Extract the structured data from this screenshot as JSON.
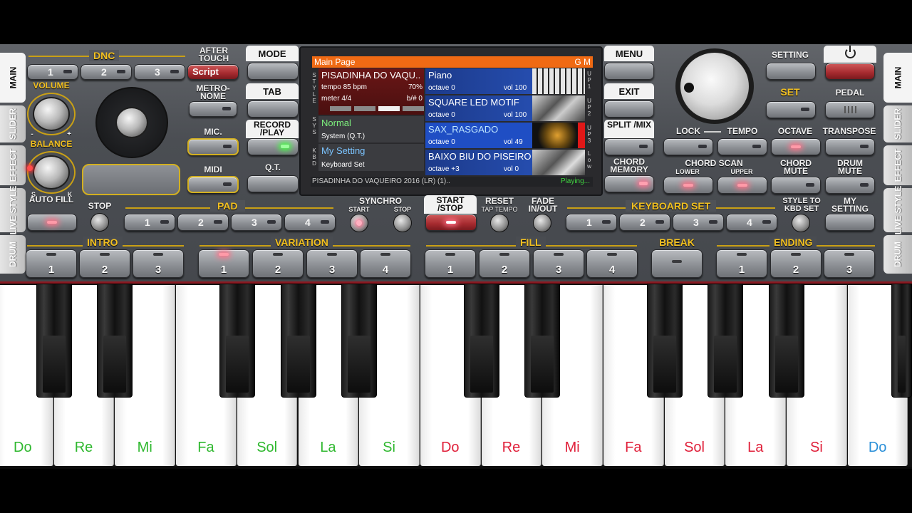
{
  "side_tabs_left": [
    "MAIN",
    "SLIDER",
    "EFFECT",
    "LIVE STYLE",
    "DRUM"
  ],
  "side_tabs_right": [
    "MAIN",
    "SLIDER",
    "EFFECT",
    "LIVE STYLE",
    "DRUM"
  ],
  "dnc": {
    "label": "DNC",
    "buttons": [
      "1",
      "2",
      "3"
    ]
  },
  "after_touch": {
    "label": "AFTER TOUCH",
    "value": "Script"
  },
  "volume_label": "VOLUME",
  "balance_label": "BALANCE",
  "balance_s": "S",
  "balance_k": "K",
  "volume_minus": "-",
  "volume_plus": "+",
  "metronome_label": "METRO-NOME",
  "mic_label": "MIC.",
  "midi_label": "MIDI",
  "mode_label": "MODE",
  "tab_label": "TAB",
  "record_label": "RECORD /PLAY",
  "qt_label": "Q.T.",
  "menu_label": "MENU",
  "exit_label": "EXIT",
  "split_label": "SPLIT /MIX",
  "chord_memory_label": "CHORD MEMORY",
  "setting_label": "SETTING",
  "set_label": "SET",
  "pedal_label": "PEDAL",
  "lock_label": "LOCK",
  "tempo_label": "TEMPO",
  "octave_label": "OCTAVE",
  "transpose_label": "TRANSPOSE",
  "chord_scan": {
    "label": "CHORD SCAN",
    "lower": "LOWER",
    "upper": "UPPER"
  },
  "chord_mute_label": "CHORD MUTE",
  "drum_mute_label": "DRUM MUTE",
  "auto_fill_label": "AUTO FILL",
  "stop_label": "STOP",
  "pad": {
    "label": "PAD",
    "buttons": [
      "1",
      "2",
      "3",
      "4"
    ]
  },
  "synchro": {
    "label": "SYNCHRO",
    "start": "START",
    "stop": "STOP"
  },
  "start_stop_label": "START /STOP",
  "reset_label": "RESET",
  "tap_tempo_label": "TAP TEMPO",
  "fade_label": "FADE IN/OUT",
  "keyboard_set": {
    "label": "KEYBOARD SET",
    "buttons": [
      "1",
      "2",
      "3",
      "4"
    ]
  },
  "style_to_kbd_label": "STYLE TO KBD SET",
  "my_setting_label": "MY SETTING",
  "intro": {
    "label": "INTRO",
    "buttons": [
      "1",
      "2",
      "3"
    ]
  },
  "variation": {
    "label": "VARIATION",
    "buttons": [
      "1",
      "2",
      "3",
      "4"
    ]
  },
  "fill": {
    "label": "FILL",
    "buttons": [
      "1",
      "2",
      "3",
      "4"
    ]
  },
  "break_label": "BREAK",
  "ending": {
    "label": "ENDING",
    "buttons": [
      "1",
      "2",
      "3"
    ]
  },
  "screen": {
    "title": "Main Page",
    "gm": "G M",
    "style_vertical": "STYLE",
    "sys_vertical": "SYS",
    "kbd_vertical": "KBD",
    "style_name": "PISADINHA DO VAQU..",
    "tempo": "tempo 85 bpm",
    "percent": "70%",
    "meter": "meter 4/4",
    "bsharp": "b/# 0",
    "system_mode": "Normal",
    "system_sub": "System (Q.T.)",
    "kbd_setting": "My Setting",
    "kbd_sub": "Keyboard Set",
    "footer_left": "PISADINHA DO VAQUEIRO 2016  (LR)  (1)..",
    "footer_right": "Playing...",
    "right_vertical": [
      "UP1",
      "UP2",
      "UP3",
      "LOW"
    ],
    "voices": [
      {
        "name": "Piano",
        "octave": "octave  0",
        "vol": "vol 100"
      },
      {
        "name": "SQUARE LED MOTIF",
        "octave": "octave  0",
        "vol": "vol 100"
      },
      {
        "name": "SAX_RASGADO",
        "octave": "octave  0",
        "vol": "vol 49"
      },
      {
        "name": "BAIXO BIU DO PISEIRO",
        "octave": "octave +3",
        "vol": "vol 0"
      }
    ]
  },
  "white_keys": [
    {
      "note": "Do",
      "color": "#2fb82f"
    },
    {
      "note": "Re",
      "color": "#2fb82f"
    },
    {
      "note": "Mi",
      "color": "#2fb82f"
    },
    {
      "note": "Fa",
      "color": "#2fb82f"
    },
    {
      "note": "Sol",
      "color": "#2fb82f"
    },
    {
      "note": "La",
      "color": "#2fb82f"
    },
    {
      "note": "Si",
      "color": "#2fb82f"
    },
    {
      "note": "Do",
      "color": "#e0203a"
    },
    {
      "note": "Re",
      "color": "#e0203a"
    },
    {
      "note": "Mi",
      "color": "#e0203a"
    },
    {
      "note": "Fa",
      "color": "#e0203a"
    },
    {
      "note": "Sol",
      "color": "#e0203a"
    },
    {
      "note": "La",
      "color": "#e0203a"
    },
    {
      "note": "Si",
      "color": "#e0203a"
    },
    {
      "note": "Do",
      "color": "#2a8fd8"
    }
  ]
}
